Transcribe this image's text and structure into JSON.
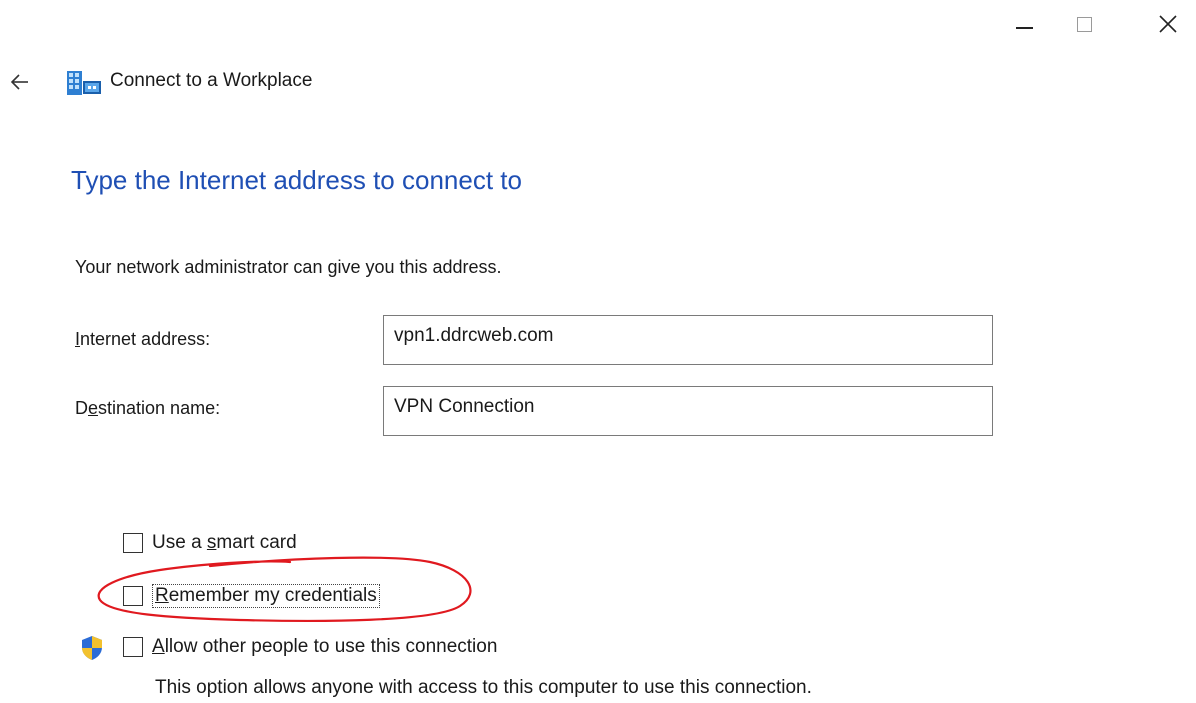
{
  "window": {
    "title": "Connect to a Workplace",
    "caption": {
      "minimize": "minimize-icon",
      "maximize": "maximize-icon",
      "close": "close-icon"
    }
  },
  "page": {
    "heading": "Type the Internet address to connect to",
    "subtext": "Your network administrator can give you this address."
  },
  "fields": {
    "address": {
      "label_first": "I",
      "label_rest": "nternet address:",
      "value": "vpn1.ddrcweb.com"
    },
    "destination": {
      "label_first": "D",
      "label_u": "e",
      "label_rest": "stination name:",
      "value": "VPN Connection"
    }
  },
  "options": {
    "smart_card": {
      "pre": "Use a ",
      "u": "s",
      "post": "mart card",
      "checked": false
    },
    "remember": {
      "u": "R",
      "post": "emember my credentials",
      "checked": false
    },
    "allow_others": {
      "u": "A",
      "post": "llow other people to use this connection",
      "checked": false,
      "description": "This option allows anyone with access to this computer to use this connection."
    }
  },
  "colors": {
    "heading": "#1f4fb4",
    "annotation": "#e0191f",
    "shield_blue": "#2b6cd6",
    "shield_yellow": "#f2c12e"
  },
  "icons": {
    "back": "back-arrow-icon",
    "app": "workplace-network-icon",
    "uac": "uac-shield-icon"
  }
}
